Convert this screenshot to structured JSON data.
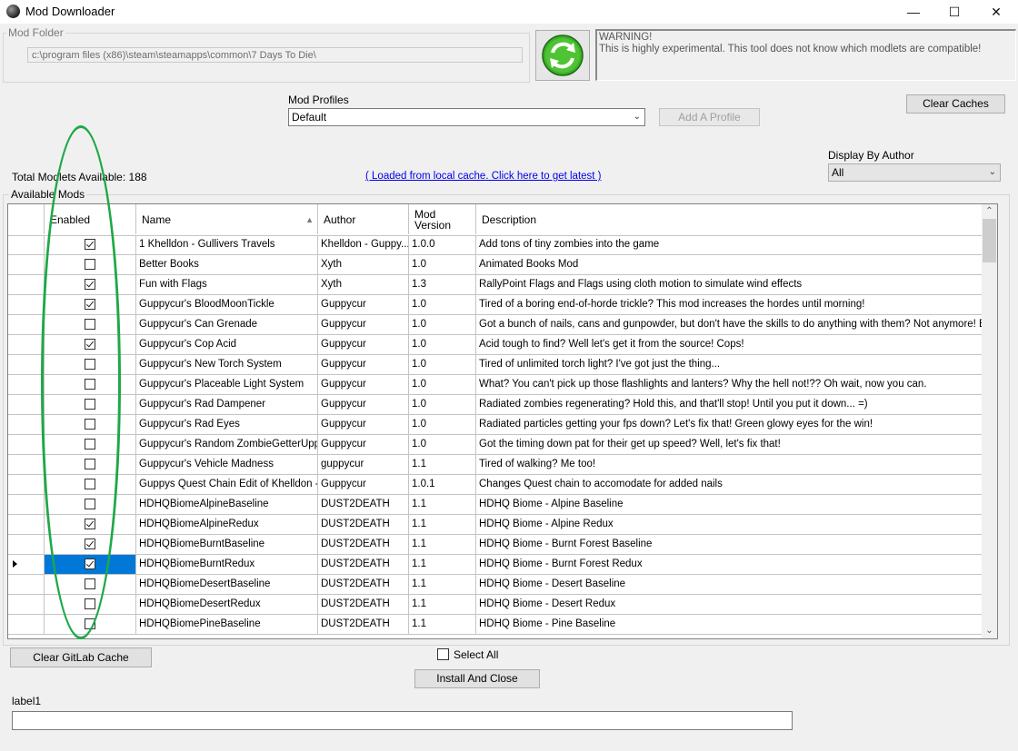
{
  "window": {
    "title": "Mod Downloader",
    "minimize": "—",
    "maximize": "☐",
    "close": "✕"
  },
  "mod_folder": {
    "label": "Mod Folder",
    "path": "c:\\program files (x86)\\steam\\steamapps\\common\\7 Days To Die\\"
  },
  "warning": {
    "line1": "WARNING!",
    "line2": "This is highly experimental. This tool does not know which modlets are compatible!"
  },
  "profiles": {
    "label": "Mod Profiles",
    "selected": "Default",
    "add_button": "Add A Profile"
  },
  "clear_caches_button": "Clear Caches",
  "author_filter": {
    "label": "Display By Author",
    "selected": "All"
  },
  "total_modlets": "Total Modlets Available: 188",
  "cache_link": "( Loaded from local cache. Click here to get latest )",
  "available_mods_label": "Available Mods",
  "grid": {
    "columns": [
      "Enabled",
      "Name",
      "Author",
      "Mod\nVersion",
      "Description"
    ],
    "rows": [
      {
        "enabled": true,
        "name": "1 Khelldon - Gullivers Travels",
        "author": "Khelldon - Guppy...",
        "version": "1.0.0",
        "description": "Add tons of tiny zombies into the game"
      },
      {
        "enabled": false,
        "name": "Better Books",
        "author": "Xyth",
        "version": "1.0",
        "description": "Animated Books Mod"
      },
      {
        "enabled": true,
        "name": "Fun with Flags",
        "author": "Xyth",
        "version": "1.3",
        "description": "RallyPoint Flags and Flags using cloth motion to simulate wind effects"
      },
      {
        "enabled": true,
        "name": "Guppycur's BloodMoonTickle",
        "author": "Guppycur",
        "version": "1.0",
        "description": "Tired of a boring end-of-horde trickle? This mod increases the hordes until morning!"
      },
      {
        "enabled": false,
        "name": "Guppycur's Can Grenade",
        "author": "Guppycur",
        "version": "1.0",
        "description": "Got a bunch of nails, cans and gunpowder, but don't have the skills to do anything with them?  Not anymore!  Blow yo"
      },
      {
        "enabled": true,
        "name": "Guppycur's Cop Acid",
        "author": "Guppycur",
        "version": "1.0",
        "description": "Acid tough to find?  Well let's get it from the source!  Cops!"
      },
      {
        "enabled": false,
        "name": "Guppycur's New Torch System",
        "author": "Guppycur",
        "version": "1.0",
        "description": "Tired of unlimited torch light?  I've got just the thing..."
      },
      {
        "enabled": false,
        "name": "Guppycur's Placeable Light System",
        "author": "Guppycur",
        "version": "1.0",
        "description": "What?  You can't pick up those flashlights and lanters?  Why the hell not!??  Oh wait, now you can."
      },
      {
        "enabled": false,
        "name": "Guppycur's Rad Dampener",
        "author": "Guppycur",
        "version": "1.0",
        "description": "Radiated zombies regenerating?  Hold this, and that'll stop!  Until you put it down... =)"
      },
      {
        "enabled": false,
        "name": "Guppycur's Rad Eyes",
        "author": "Guppycur",
        "version": "1.0",
        "description": "Radiated particles getting your fps down?  Let's fix that!  Green glowy eyes for the win!"
      },
      {
        "enabled": false,
        "name": "Guppycur's Random ZombieGetterUpper",
        "author": "Guppycur",
        "version": "1.0",
        "description": "Got the timing down pat for their get up speed?  Well, let's fix that!"
      },
      {
        "enabled": false,
        "name": "Guppycur's Vehicle Madness",
        "author": "guppycur",
        "version": "1.1",
        "description": "Tired of walking?  Me too!"
      },
      {
        "enabled": false,
        "name": "Guppys Quest Chain Edit of Khelldon - ...",
        "author": "Guppycur",
        "version": "1.0.1",
        "description": "Changes Quest chain to accomodate for added nails"
      },
      {
        "enabled": false,
        "name": "HDHQBiomeAlpineBaseline",
        "author": "DUST2DEATH",
        "version": "1.1",
        "description": "HDHQ Biome - Alpine Baseline"
      },
      {
        "enabled": true,
        "name": "HDHQBiomeAlpineRedux",
        "author": "DUST2DEATH",
        "version": "1.1",
        "description": "HDHQ Biome - Alpine Redux"
      },
      {
        "enabled": true,
        "name": "HDHQBiomeBurntBaseline",
        "author": "DUST2DEATH",
        "version": "1.1",
        "description": "HDHQ Biome - Burnt Forest Baseline"
      },
      {
        "enabled": true,
        "name": "HDHQBiomeBurntRedux",
        "author": "DUST2DEATH",
        "version": "1.1",
        "description": "HDHQ Biome - Burnt Forest Redux",
        "selected": true
      },
      {
        "enabled": false,
        "name": "HDHQBiomeDesertBaseline",
        "author": "DUST2DEATH",
        "version": "1.1",
        "description": "HDHQ Biome - Desert Baseline"
      },
      {
        "enabled": false,
        "name": "HDHQBiomeDesertRedux",
        "author": "DUST2DEATH",
        "version": "1.1",
        "description": "HDHQ Biome - Desert Redux"
      },
      {
        "enabled": false,
        "name": "HDHQBiomePineBaseline",
        "author": "DUST2DEATH",
        "version": "1.1",
        "description": "HDHQ Biome - Pine Baseline"
      }
    ]
  },
  "clear_gitlab_button": "Clear GitLab Cache",
  "select_all_label": "Select All",
  "install_button": "Install And Close",
  "label1": "label1",
  "colors": {
    "selection": "#0078d7",
    "annotation_circle": "#1fa847",
    "link": "#0000ee"
  }
}
